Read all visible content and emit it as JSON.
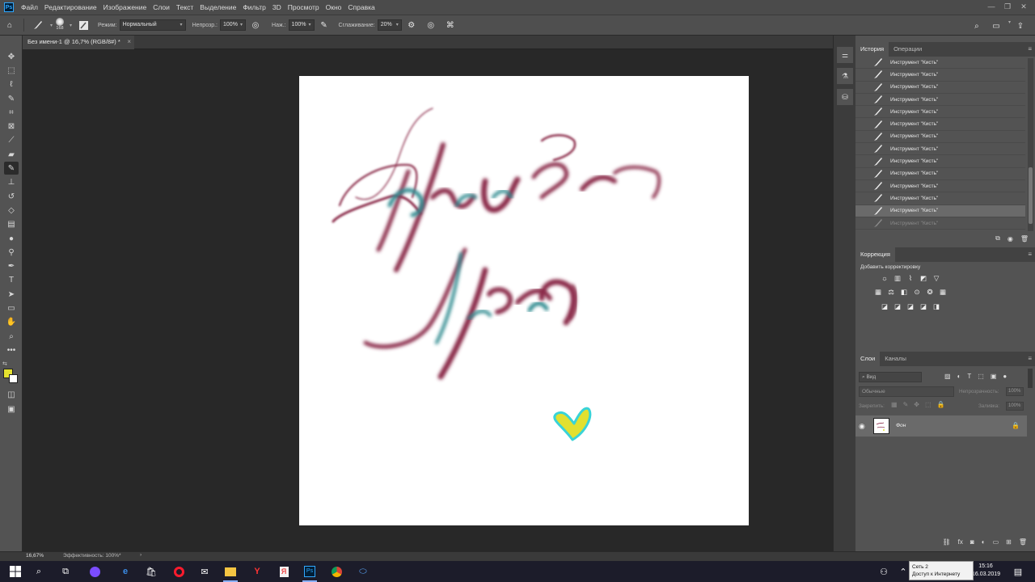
{
  "menubar": {
    "logo": "Ps",
    "items": [
      "Файл",
      "Редактирование",
      "Изображение",
      "Слои",
      "Текст",
      "Выделение",
      "Фильтр",
      "3D",
      "Просмотр",
      "Окно",
      "Справка"
    ],
    "window_controls": [
      "—",
      "❐",
      "✕"
    ]
  },
  "options": {
    "brush_size": "168",
    "mode_label": "Режим:",
    "mode_value": "Нормальный",
    "opacity_label": "Непрозр.:",
    "opacity_value": "100%",
    "flow_label": "Наж.:",
    "flow_value": "100%",
    "smoothing_label": "Сглаживание:",
    "smoothing_value": "20%"
  },
  "document": {
    "tab_title": "Без имени-1 @ 16,7% (RGB/8#) *",
    "close": "×",
    "canvas_bg": "#ffffff",
    "ink_color": "#8a2a48",
    "teal_color": "#2f8a8f",
    "heart_fill": "#e2e030",
    "heart_stroke": "#39d3d8"
  },
  "toolbar": {
    "icons": [
      "move-icon",
      "marquee-icon",
      "lasso-icon",
      "quick-select-icon",
      "crop-icon",
      "frame-icon",
      "eyedropper-icon",
      "healing-icon",
      "brush-icon",
      "stamp-icon",
      "history-brush-icon",
      "eraser-icon",
      "gradient-icon",
      "blur-icon",
      "dodge-icon",
      "pen-icon",
      "type-icon",
      "path-select-icon",
      "rectangle-icon",
      "hand-icon",
      "zoom-icon",
      "more-icon"
    ],
    "foreground_color": "#e5e22f",
    "background_color": "#ffffff"
  },
  "history": {
    "tab_active": "История",
    "tab_other": "Операции",
    "entries": [
      "Инструмент \"Кисть\"",
      "Инструмент \"Кисть\"",
      "Инструмент \"Кисть\"",
      "Инструмент \"Кисть\"",
      "Инструмент \"Кисть\"",
      "Инструмент \"Кисть\"",
      "Инструмент \"Кисть\"",
      "Инструмент \"Кисть\"",
      "Инструмент \"Кисть\"",
      "Инструмент \"Кисть\"",
      "Инструмент \"Кисть\"",
      "Инструмент \"Кисть\"",
      "Инструмент \"Кисть\"",
      "Инструмент \"Кисть\""
    ],
    "current_index": 12
  },
  "corrections": {
    "tab": "Коррекция",
    "add_label": "Добавить корректировку"
  },
  "layers": {
    "tab_active": "Слои",
    "tab_other": "Каналы",
    "filter_placeholder": "Вид",
    "blend_mode": "Обычные",
    "opacity_label": "Непрозрачность:",
    "opacity_value": "100%",
    "lock_label": "Закрепить:",
    "fill_label": "Заливка:",
    "fill_value": "100%",
    "layer_name": "Фон"
  },
  "status": {
    "zoom": "16,67%",
    "efficiency": "Эффективность: 100%*",
    "arrow": "›"
  },
  "taskbar": {
    "clock_time": "15:16",
    "clock_date": "16.03.2019",
    "network_popup_line1": "Сеть 2",
    "network_popup_line2": "Доступ к Интернету"
  }
}
